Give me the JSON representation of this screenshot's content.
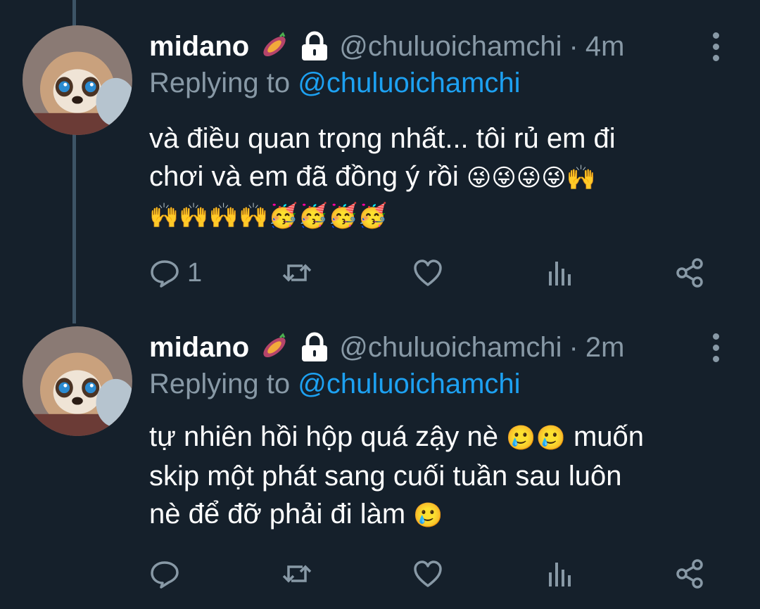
{
  "tweets": [
    {
      "name": "midano",
      "handle": "@chuluoichamchi",
      "separator": "·",
      "time": "4m",
      "replying_prefix": "Replying to",
      "replying_to": "@chuluoichamchi",
      "text_line1": "và điều quan trọng nhất... tôi rủ em đi",
      "text_line2": "chơi và em đã đồng ý rồi",
      "emoji_line2": "😜😜😜😜🙌",
      "emoji_line3": "🙌🙌🙌🙌🥳🥳🥳🥳",
      "reply_count": "1",
      "retweet_count": "",
      "like_count": ""
    },
    {
      "name": "midano",
      "handle": "@chuluoichamchi",
      "separator": "·",
      "time": "2m",
      "replying_prefix": "Replying to",
      "replying_to": "@chuluoichamchi",
      "text_line1a": "tự nhiên hồi hộp quá zậy nè",
      "emoji_line1": "🥲🥲",
      "text_line1b": "muốn",
      "text_line2": "skip một phát sang cuối tuần sau luôn",
      "text_line3": "nè để đỡ phải đi làm",
      "emoji_line3": "🥲",
      "reply_count": "",
      "retweet_count": "",
      "like_count": ""
    }
  ],
  "icons": {
    "badge": "sweet-potato-icon",
    "protected": "lock-icon",
    "reply": "reply-icon",
    "retweet": "retweet-icon",
    "like": "heart-icon",
    "analytics": "analytics-icon",
    "share": "share-icon",
    "more": "more-vertical-icon"
  },
  "colors": {
    "background": "#15202b",
    "secondary_text": "#8899a6",
    "accent": "#1da1f2",
    "thread_line": "#3d5466"
  }
}
